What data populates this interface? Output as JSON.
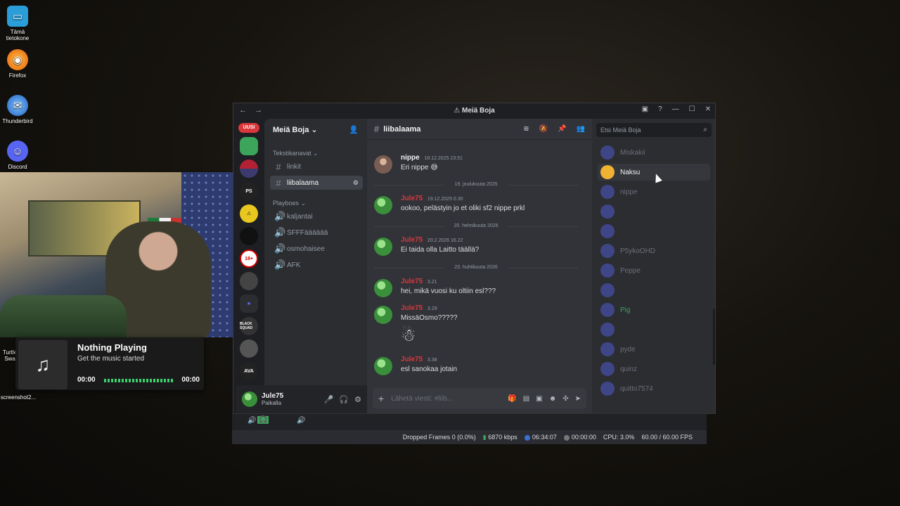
{
  "desktop": {
    "icons": [
      {
        "label": "Tämä tietokone",
        "icon": "computer-icon"
      },
      {
        "label": "Firefox",
        "icon": "firefox-icon"
      },
      {
        "label": "Thunderbird",
        "icon": "thunderbird-icon"
      },
      {
        "label": "Discord",
        "icon": "discord-icon"
      },
      {
        "label": "Turtle Swa",
        "icon": "app-icon"
      },
      {
        "label": "screenshot2...",
        "icon": "file-icon"
      }
    ]
  },
  "music": {
    "title": "Nothing Playing",
    "subtitle": "Get the music started",
    "time_current": "00:00",
    "time_total": "00:00",
    "note_glyph": "♫"
  },
  "window": {
    "title": "Meiä Boja",
    "nav_glyphs": "← →"
  },
  "servers": {
    "new_badge": "UUSI",
    "items": [
      "",
      "",
      "PS",
      "",
      "",
      "18+",
      "",
      "",
      "BLACK SQUAD",
      "",
      "AVA"
    ]
  },
  "guild": {
    "name": "Meiä Boja",
    "text_category": "Tekstikanavat",
    "text_channels": [
      {
        "name": "linkit",
        "active": false
      },
      {
        "name": "liibalaama",
        "active": true
      }
    ],
    "voice_category": "Playboes",
    "voice_channels": [
      "kaljantai",
      "SFFFääääää",
      "osmohaisee",
      "AFK"
    ]
  },
  "user": {
    "name": "Jule75",
    "status": "Paikalla"
  },
  "chat": {
    "channel": "liibalaama",
    "composer_placeholder": "Lähetä viesti: #liib...",
    "messages": [
      {
        "author": "nippe",
        "time": "18.12.2025 23.51",
        "text": "Eri nippe 😅",
        "author_color": "#f2f3f5"
      },
      {
        "divider": "19. joulukuuta 2025"
      },
      {
        "author": "Jule75",
        "time": "19.12.2025 0.30",
        "text": "ookoo, pelästyin jo et oliki sf2 nippe prkl",
        "author_color": "#da373c"
      },
      {
        "divider": "20. helmikuuta 2026"
      },
      {
        "author": "Jule75",
        "time": "20.2.2026 16.22",
        "text": "Ei taida olla Laitto täällä?",
        "author_color": "#da373c"
      },
      {
        "divider": "23. huhtikuuta 2026"
      },
      {
        "author": "Jule75",
        "time": "3.21",
        "text": "hei, mikä vuosi ku oltiin esl???",
        "author_color": "#da373c"
      },
      {
        "author": "Jule75",
        "time": "3.29",
        "text": "MissäOsmo?????",
        "author_color": "#da373c"
      },
      {
        "author": "Jule75",
        "time": "3.38",
        "text": "esl sanokaa jotain",
        "author_color": "#da373c"
      }
    ]
  },
  "members": {
    "search_placeholder": "Etsi Meiä Boja",
    "list": [
      {
        "name": "Miskakii",
        "color": "#6d6f78"
      },
      {
        "name": "Naksu",
        "color": "#f2f3f5",
        "hover": true
      },
      {
        "name": "nippe",
        "color": "#6d6f78"
      },
      {
        "name": "",
        "color": "#8a3a3a"
      },
      {
        "name": "",
        "color": "#8a3a3a"
      },
      {
        "name": "P5ykoOHD",
        "color": "#6d6f78"
      },
      {
        "name": "Peppe",
        "color": "#6d6f78"
      },
      {
        "name": "",
        "color": "#8a3a3a"
      },
      {
        "name": "Pig",
        "color": "#3ba55c"
      },
      {
        "name": "",
        "color": "#8a3a3a"
      },
      {
        "name": "pyde",
        "color": "#6d6f78"
      },
      {
        "name": "quinz",
        "color": "#6d6f78"
      },
      {
        "name": "quitto7574",
        "color": "#6d6f78"
      }
    ]
  },
  "obs": {
    "dropped_frames": "Dropped Frames 0 (0.0%)",
    "bitrate": "6870 kbps",
    "live_time": "06:34:07",
    "rec_time": "00:00:00",
    "cpu": "CPU: 3.0%",
    "fps": "60.00 / 60.00 FPS"
  },
  "colors": {
    "accent_red": "#da373c",
    "online_green": "#3ba55c",
    "background": "#1e1f22"
  }
}
